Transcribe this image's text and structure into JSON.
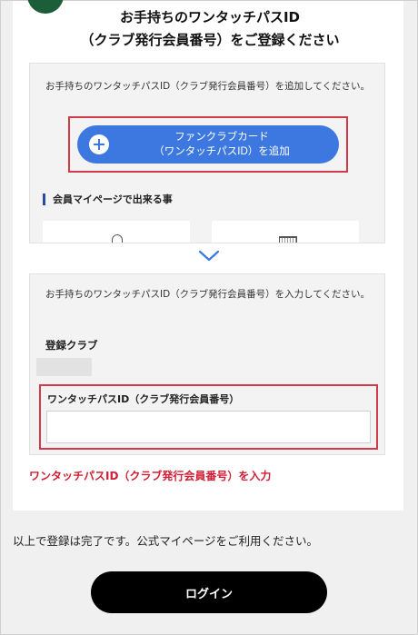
{
  "heading": {
    "line1": "お手持ちのワンタッチパスID",
    "line2": "（クラブ発行会員番号）をご登録ください"
  },
  "add_section": {
    "description": "お手持ちのワンタッチパスID（クラブ発行会員番号）を追加してください。",
    "button_line1": "ファンクラブカード",
    "button_line2": "（ワンタッチパスID）を追加",
    "features_title": "会員マイページで出来る事",
    "feature_icons": [
      "user-icon",
      "calendar-icon"
    ]
  },
  "input_section": {
    "description": "お手持ちのワンタッチパスID（クラブ発行会員番号）を入力してください。",
    "club_label": "登録クラブ",
    "club_value": "",
    "pass_label": "ワンタッチパスID（クラブ発行会員番号）",
    "pass_value": ""
  },
  "annotation": {
    "red_note": "ワンタッチパスID（クラブ発行会員番号）を入力"
  },
  "footer": {
    "complete_text": "以上で登録は完了です。公式マイページをご利用ください。",
    "login_label": "ログイン"
  },
  "colors": {
    "accent_blue": "#3c78e0",
    "highlight_red": "#d23a4a",
    "note_red": "#d01f35",
    "step_badge_green": "#1d5e3a",
    "login_black": "#000000"
  }
}
